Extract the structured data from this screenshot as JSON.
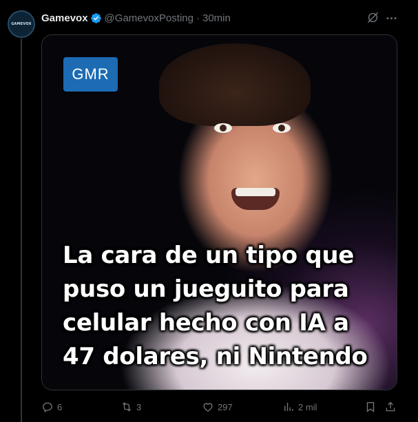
{
  "author": {
    "avatar_text": "GAMEVOX",
    "display_name": "Gamevox",
    "handle": "@GamevoxPosting",
    "separator": "·",
    "time": "30min",
    "verified_color": "#1d9bf0"
  },
  "media": {
    "badge": "GMR",
    "badge_color": "#1c6bb3",
    "caption_lines": [
      "La cara de un tipo que",
      "puso un jueguito para",
      "celular hecho con IA a",
      "47 dolares, ni Nintendo"
    ]
  },
  "actions": {
    "replies": "6",
    "reposts": "3",
    "likes": "297",
    "views": "2 mil"
  },
  "icons": {
    "header": [
      "grok-icon",
      "more-icon"
    ],
    "actions": [
      "reply-icon",
      "repost-icon",
      "like-icon",
      "views-icon",
      "bookmark-icon",
      "share-icon"
    ]
  },
  "colors": {
    "background": "#000000",
    "text": "#e7e9ea",
    "muted": "#71767b",
    "border": "#2f3336"
  }
}
